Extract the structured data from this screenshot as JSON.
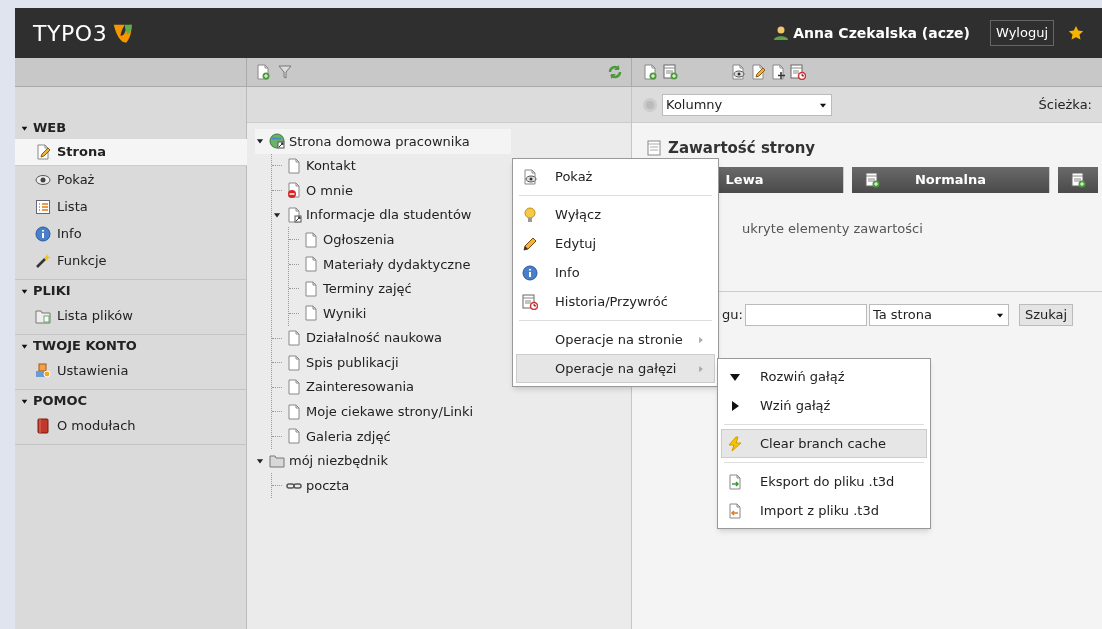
{
  "header": {
    "logo": "TYPO3",
    "user": "Anna Czekalska (acze)",
    "logout": "Wyloguj"
  },
  "sidebar": [
    {
      "title": "WEB",
      "expanded": true,
      "items": [
        {
          "label": "Strona",
          "selected": true
        },
        {
          "label": "Pokaż",
          "selected": false
        },
        {
          "label": "Lista",
          "selected": false
        },
        {
          "label": "Info",
          "selected": false
        },
        {
          "label": "Funkcje",
          "selected": false
        }
      ]
    },
    {
      "title": "PLIKI",
      "expanded": true,
      "items": [
        {
          "label": "Lista plików",
          "selected": false
        }
      ]
    },
    {
      "title": "TWOJE KONTO",
      "expanded": true,
      "items": [
        {
          "label": "Ustawienia",
          "selected": false
        }
      ]
    },
    {
      "title": "POMOC",
      "expanded": true,
      "items": [
        {
          "label": "O modułach",
          "selected": false
        }
      ]
    }
  ],
  "tree": [
    {
      "label": "Strona domowa pracownika",
      "kind": "root",
      "expanded": true,
      "selected": true,
      "children": [
        {
          "label": "Kontakt",
          "kind": "page"
        },
        {
          "label": "O mnie",
          "kind": "hidden"
        },
        {
          "label": "Informacje dla studentów",
          "kind": "shortcut",
          "expanded": true,
          "children": [
            {
              "label": "Ogłoszenia",
              "kind": "page"
            },
            {
              "label": "Materiały dydaktyczne",
              "kind": "page"
            },
            {
              "label": "Terminy zajęć",
              "kind": "page"
            },
            {
              "label": "Wyniki",
              "kind": "page"
            }
          ]
        },
        {
          "label": "Działalność naukowa",
          "kind": "page"
        },
        {
          "label": "Spis publikacji",
          "kind": "page"
        },
        {
          "label": "Zainteresowania",
          "kind": "page"
        },
        {
          "label": "Moje ciekawe strony/Linki",
          "kind": "page"
        },
        {
          "label": "Galeria zdjęć",
          "kind": "page"
        }
      ]
    },
    {
      "label": "mój niezbędnik",
      "kind": "folder",
      "expanded": true,
      "selected": false,
      "children": [
        {
          "label": "poczta",
          "kind": "link"
        }
      ]
    }
  ],
  "content": {
    "view_select": "Kolumny",
    "path_label": "Ścieżka:",
    "title": "Zawartość strony",
    "columns": [
      "Lewa",
      "Normalna"
    ],
    "hidden_label": "ukryte elementy zawartości",
    "search_label": "gu:",
    "scope_select": "Ta strona",
    "search_button": "Szukaj"
  },
  "context_menu": [
    {
      "kind": "item",
      "label": "Pokaż",
      "selected": false
    },
    {
      "kind": "separator"
    },
    {
      "kind": "item",
      "label": "Wyłącz",
      "selected": false
    },
    {
      "kind": "item",
      "label": "Edytuj",
      "selected": false
    },
    {
      "kind": "item",
      "label": "Info",
      "selected": false
    },
    {
      "kind": "item",
      "label": "Historia/Przywróć",
      "selected": false
    },
    {
      "kind": "separator"
    },
    {
      "kind": "submenu",
      "label": "Operacje na stronie",
      "selected": false
    },
    {
      "kind": "submenu",
      "label": "Operacje na gałęzi",
      "selected": true
    }
  ],
  "submenu": [
    {
      "kind": "item",
      "label": "Rozwiń gałąź",
      "selected": false
    },
    {
      "kind": "item",
      "label": "Wziń gałąź",
      "selected": false
    },
    {
      "kind": "separator"
    },
    {
      "kind": "item",
      "label": "Clear branch cache",
      "selected": true
    },
    {
      "kind": "separator"
    },
    {
      "kind": "item",
      "label": "Eksport do pliku .t3d",
      "selected": false
    },
    {
      "kind": "item",
      "label": "Import z pliku .t3d",
      "selected": false
    }
  ]
}
